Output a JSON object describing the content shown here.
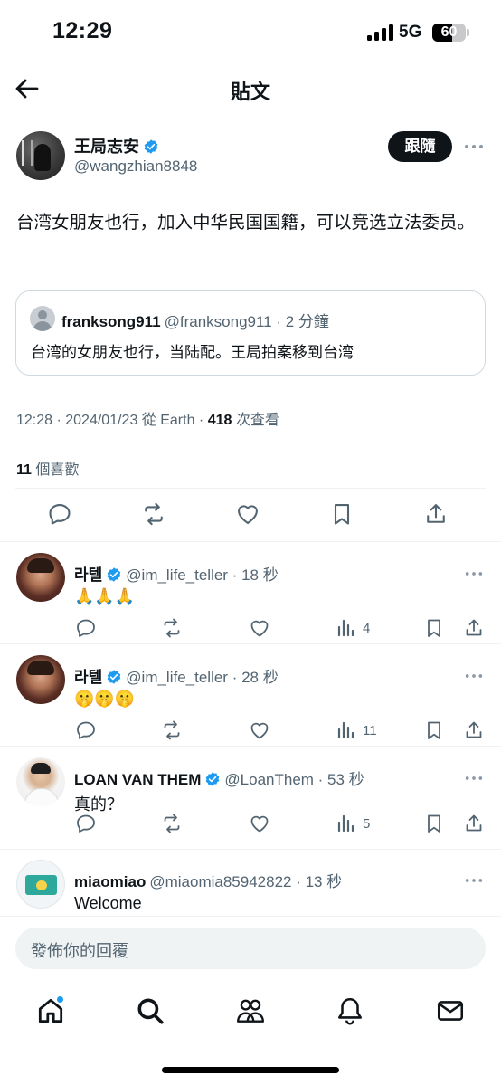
{
  "status_bar": {
    "time": "12:29",
    "network": "5G",
    "battery": "60",
    "battery_level": 0.6
  },
  "header": {
    "title": "貼文"
  },
  "author": {
    "name": "王局志安",
    "handle": "@wangzhian8848",
    "follow_label": "跟隨"
  },
  "tweet": {
    "text": "台湾女朋友也行，加入中华民国国籍，可以竞选立法委员。"
  },
  "quote": {
    "name": "franksong911",
    "handle_time": "@franksong911 · 2 分鐘",
    "text": "台湾的女朋友也行，当陆配。王局拍案移到台湾"
  },
  "meta": {
    "timestamp": "12:28 · 2024/01/23 從 Earth · ",
    "views_count": "418",
    "views_label": " 次查看"
  },
  "likes": {
    "count": "11",
    "label": " 個喜歡"
  },
  "replies": [
    {
      "name": "라텔",
      "meta": "@im_life_teller · 18 秒",
      "text": "🙏🙏🙏",
      "views": "4"
    },
    {
      "name": "라텔",
      "meta": "@im_life_teller · 28 秒",
      "text": "🤫🤫🤫",
      "views": "11"
    },
    {
      "name": "LOAN VAN THEM",
      "meta": "@LoanThem · 53 秒",
      "text": "真的？",
      "views": "5"
    },
    {
      "name": "miaomiao",
      "meta": "@miaomia85942822 · 13 秒",
      "text": "Welcome",
      "views": ""
    }
  ],
  "composer": {
    "placeholder": "發佈你的回覆"
  },
  "colors": {
    "accent": "#1d9bf0",
    "text": "#0f1419",
    "secondary": "#536471",
    "border": "#cfd9de"
  }
}
